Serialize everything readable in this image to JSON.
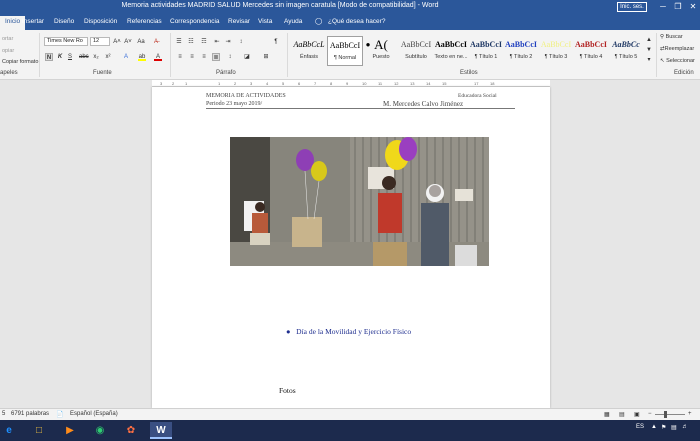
{
  "window": {
    "title": "Memoria actividades MADRID SALUD Mercedes sin imagen caratula [Modo de compatibilidad] - Word",
    "signin": "Inic. ses.",
    "minimize_glyph": "─",
    "maximize_glyph": "❐",
    "close_glyph": "✕"
  },
  "tabs": [
    {
      "label": "chivo"
    },
    {
      "label": "Inicio"
    },
    {
      "label": "Insertar"
    },
    {
      "label": "Diseño"
    },
    {
      "label": "Disposición"
    },
    {
      "label": "Referencias"
    },
    {
      "label": "Correspondencia"
    },
    {
      "label": "Revisar"
    },
    {
      "label": "Vista"
    },
    {
      "label": "Ayuda"
    },
    {
      "label": "¿Qué desea hacer?"
    }
  ],
  "ribbon": {
    "clipboard": {
      "cut": "ortar",
      "copy": "opiar",
      "format_painter": "Copiar formato",
      "label": "apeles"
    },
    "font": {
      "family": "Times New Ro",
      "size": "12",
      "grow": "A˄",
      "shrink": "A˅",
      "case": "Aa",
      "clear": "A̶",
      "bold": "N",
      "italic": "K",
      "underline": "S",
      "strike": "abc",
      "subscript": "x₂",
      "superscript": "x²",
      "effects": "A",
      "highlight": "ab",
      "color": "A",
      "label": "Fuente"
    },
    "paragraph": {
      "bullets": "☰",
      "numbering": "☷",
      "multilevel": "☶",
      "decrease": "⇤",
      "increase": "⇥",
      "sort": "↕",
      "pilcrow": "¶",
      "align_left": "≡",
      "center": "≡",
      "align_right": "≡",
      "justify": "≣",
      "spacing": "↕",
      "shading": "◪",
      "borders": "⊞",
      "label": "Párrafo"
    },
    "styles": {
      "label": "Estilos",
      "items": [
        {
          "preview": "AaBbCcL",
          "name": "Énfasis",
          "color": "#000000"
        },
        {
          "preview": "AaBbCcI",
          "name": "¶ Normal",
          "color": "#000000"
        },
        {
          "preview": "●",
          "name": "",
          "color": "#000000"
        },
        {
          "preview": "A(",
          "name": "Puesto",
          "color": "#000000"
        },
        {
          "preview": "AaBbCcI",
          "name": "Subtítulo",
          "color": "#444444"
        },
        {
          "preview": "AaBbCcI",
          "name": "Texto en ne...",
          "color": "#000000"
        },
        {
          "preview": "AaBbCcI",
          "name": "¶ Título 1",
          "color": "#1f3864"
        },
        {
          "preview": "AaBbCcI",
          "name": "¶ Título 2",
          "color": "#1f3fbf"
        },
        {
          "preview": "AaBbCcI",
          "name": "¶ Título 3",
          "color": "#f0f080"
        },
        {
          "preview": "AaBbCcI",
          "name": "¶ Título 4",
          "color": "#b22222"
        },
        {
          "preview": "AaBbCc",
          "name": "¶ Título 5",
          "color": "#1f3864"
        }
      ]
    },
    "editing": {
      "find": "Buscar",
      "replace": "Reemplazar",
      "select": "Seleccionar",
      "label": "Edición"
    }
  },
  "ruler": {
    "numbers": [
      "3",
      "2",
      "1",
      "1",
      "2",
      "3",
      "4",
      "5",
      "6",
      "7",
      "8",
      "9",
      "10",
      "11",
      "12",
      "13",
      "14",
      "15",
      "17",
      "18"
    ]
  },
  "document": {
    "header_left_1": "MEMORIA DE ACTIVIDADES",
    "header_left_2": "Periodo 23 mayo 2019/",
    "header_right_1": "Educadora Social",
    "header_right_2": "M. Mercedes Calvo Jiménez",
    "bullet_text": "Día de la Movilidad y Ejercicio Físico",
    "fotos_label": "Fotos"
  },
  "statusbar": {
    "page": "5",
    "words": "6791 palabras",
    "language": "Español (España)"
  },
  "taskbar": {
    "lang": "ES",
    "icons": [
      "start-icon",
      "ie-icon",
      "explorer-icon",
      "media-icon",
      "chrome-icon",
      "app-icon",
      "word-icon"
    ]
  }
}
